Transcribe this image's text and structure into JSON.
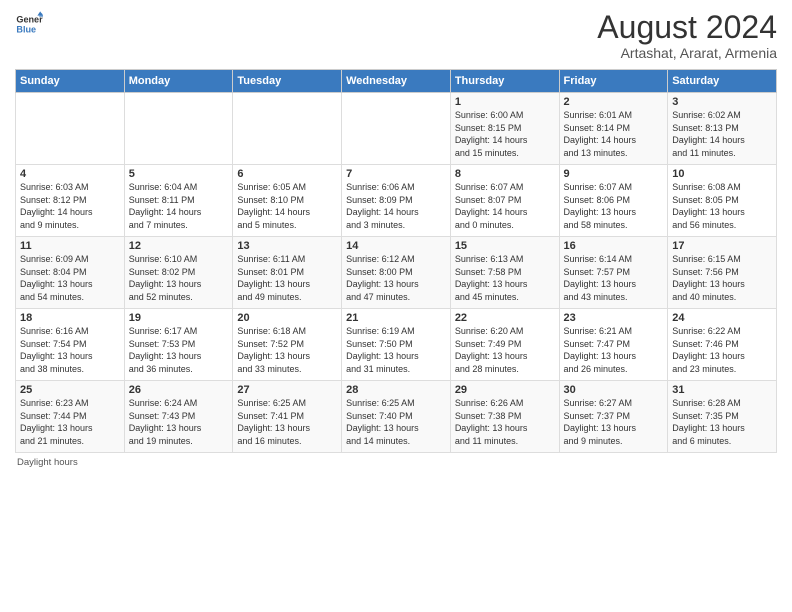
{
  "logo": {
    "line1": "General",
    "line2": "Blue"
  },
  "title": "August 2024",
  "subtitle": "Artashat, Ararat, Armenia",
  "days_of_week": [
    "Sunday",
    "Monday",
    "Tuesday",
    "Wednesday",
    "Thursday",
    "Friday",
    "Saturday"
  ],
  "footer": "Daylight hours",
  "weeks": [
    [
      {
        "day": "",
        "info": ""
      },
      {
        "day": "",
        "info": ""
      },
      {
        "day": "",
        "info": ""
      },
      {
        "day": "",
        "info": ""
      },
      {
        "day": "1",
        "info": "Sunrise: 6:00 AM\nSunset: 8:15 PM\nDaylight: 14 hours\nand 15 minutes."
      },
      {
        "day": "2",
        "info": "Sunrise: 6:01 AM\nSunset: 8:14 PM\nDaylight: 14 hours\nand 13 minutes."
      },
      {
        "day": "3",
        "info": "Sunrise: 6:02 AM\nSunset: 8:13 PM\nDaylight: 14 hours\nand 11 minutes."
      }
    ],
    [
      {
        "day": "4",
        "info": "Sunrise: 6:03 AM\nSunset: 8:12 PM\nDaylight: 14 hours\nand 9 minutes."
      },
      {
        "day": "5",
        "info": "Sunrise: 6:04 AM\nSunset: 8:11 PM\nDaylight: 14 hours\nand 7 minutes."
      },
      {
        "day": "6",
        "info": "Sunrise: 6:05 AM\nSunset: 8:10 PM\nDaylight: 14 hours\nand 5 minutes."
      },
      {
        "day": "7",
        "info": "Sunrise: 6:06 AM\nSunset: 8:09 PM\nDaylight: 14 hours\nand 3 minutes."
      },
      {
        "day": "8",
        "info": "Sunrise: 6:07 AM\nSunset: 8:07 PM\nDaylight: 14 hours\nand 0 minutes."
      },
      {
        "day": "9",
        "info": "Sunrise: 6:07 AM\nSunset: 8:06 PM\nDaylight: 13 hours\nand 58 minutes."
      },
      {
        "day": "10",
        "info": "Sunrise: 6:08 AM\nSunset: 8:05 PM\nDaylight: 13 hours\nand 56 minutes."
      }
    ],
    [
      {
        "day": "11",
        "info": "Sunrise: 6:09 AM\nSunset: 8:04 PM\nDaylight: 13 hours\nand 54 minutes."
      },
      {
        "day": "12",
        "info": "Sunrise: 6:10 AM\nSunset: 8:02 PM\nDaylight: 13 hours\nand 52 minutes."
      },
      {
        "day": "13",
        "info": "Sunrise: 6:11 AM\nSunset: 8:01 PM\nDaylight: 13 hours\nand 49 minutes."
      },
      {
        "day": "14",
        "info": "Sunrise: 6:12 AM\nSunset: 8:00 PM\nDaylight: 13 hours\nand 47 minutes."
      },
      {
        "day": "15",
        "info": "Sunrise: 6:13 AM\nSunset: 7:58 PM\nDaylight: 13 hours\nand 45 minutes."
      },
      {
        "day": "16",
        "info": "Sunrise: 6:14 AM\nSunset: 7:57 PM\nDaylight: 13 hours\nand 43 minutes."
      },
      {
        "day": "17",
        "info": "Sunrise: 6:15 AM\nSunset: 7:56 PM\nDaylight: 13 hours\nand 40 minutes."
      }
    ],
    [
      {
        "day": "18",
        "info": "Sunrise: 6:16 AM\nSunset: 7:54 PM\nDaylight: 13 hours\nand 38 minutes."
      },
      {
        "day": "19",
        "info": "Sunrise: 6:17 AM\nSunset: 7:53 PM\nDaylight: 13 hours\nand 36 minutes."
      },
      {
        "day": "20",
        "info": "Sunrise: 6:18 AM\nSunset: 7:52 PM\nDaylight: 13 hours\nand 33 minutes."
      },
      {
        "day": "21",
        "info": "Sunrise: 6:19 AM\nSunset: 7:50 PM\nDaylight: 13 hours\nand 31 minutes."
      },
      {
        "day": "22",
        "info": "Sunrise: 6:20 AM\nSunset: 7:49 PM\nDaylight: 13 hours\nand 28 minutes."
      },
      {
        "day": "23",
        "info": "Sunrise: 6:21 AM\nSunset: 7:47 PM\nDaylight: 13 hours\nand 26 minutes."
      },
      {
        "day": "24",
        "info": "Sunrise: 6:22 AM\nSunset: 7:46 PM\nDaylight: 13 hours\nand 23 minutes."
      }
    ],
    [
      {
        "day": "25",
        "info": "Sunrise: 6:23 AM\nSunset: 7:44 PM\nDaylight: 13 hours\nand 21 minutes."
      },
      {
        "day": "26",
        "info": "Sunrise: 6:24 AM\nSunset: 7:43 PM\nDaylight: 13 hours\nand 19 minutes."
      },
      {
        "day": "27",
        "info": "Sunrise: 6:25 AM\nSunset: 7:41 PM\nDaylight: 13 hours\nand 16 minutes."
      },
      {
        "day": "28",
        "info": "Sunrise: 6:25 AM\nSunset: 7:40 PM\nDaylight: 13 hours\nand 14 minutes."
      },
      {
        "day": "29",
        "info": "Sunrise: 6:26 AM\nSunset: 7:38 PM\nDaylight: 13 hours\nand 11 minutes."
      },
      {
        "day": "30",
        "info": "Sunrise: 6:27 AM\nSunset: 7:37 PM\nDaylight: 13 hours\nand 9 minutes."
      },
      {
        "day": "31",
        "info": "Sunrise: 6:28 AM\nSunset: 7:35 PM\nDaylight: 13 hours\nand 6 minutes."
      }
    ]
  ]
}
